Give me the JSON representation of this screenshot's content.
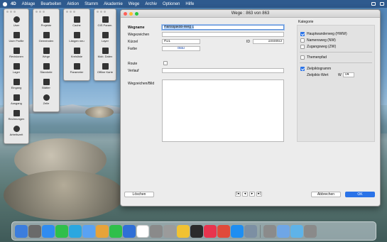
{
  "menubar": {
    "app": "4D",
    "items": [
      "Ablage",
      "Bearbeiten",
      "Aktion",
      "Stamm",
      "Akademie",
      "Wege",
      "Archiv",
      "Optionen",
      "Hilfe"
    ]
  },
  "palettes": {
    "p1": [
      "User",
      "User Profile",
      "Revisionen",
      "Lager",
      "Eingang",
      "Ausgang",
      "Rechnungen",
      "Arbeitszeit"
    ],
    "p2": [
      "Projekte",
      "Gemeinden",
      "Wege",
      "Standorte",
      "Blätter",
      "Zeile"
    ],
    "p3": [
      "Cache",
      "Längen neu",
      "Kreisliste",
      "Parameter"
    ],
    "p4": [
      "GIS Param.",
      "Layer",
      "Mob. Daten",
      "Offline Karte"
    ]
  },
  "window": {
    "title": "Wege : 863 von 863",
    "labels": {
      "wegname": "Wegname",
      "wegezeichen": "Wegezeichen",
      "kuerzel": "Kürzel",
      "farbe": "Farbe",
      "id": "ID",
      "route": "Route",
      "verlauf": "Verlauf",
      "wegzeichen_bild": "Wegzeichen/Bild"
    },
    "values": {
      "wegname": "Hanssjakob-Weg 1",
      "kuerzel": "HJ1",
      "farbe": "blau",
      "id": "1000003"
    },
    "kategorie": {
      "title": "Kategorie",
      "items": [
        {
          "label": "Hauptwanderweg (HWW)",
          "checked": true
        },
        {
          "label": "Namensweg (NW)",
          "checked": false
        },
        {
          "label": "Zugangsweg (ZW)",
          "checked": false
        },
        {
          "label": "Themenpfad",
          "checked": false
        },
        {
          "label": "Zielpiktogramm",
          "checked": true
        }
      ],
      "zielpikto_label": "Zielpikto Wert",
      "zielpikto_prefix": "W",
      "zielpikto_value": "04"
    },
    "buttons": {
      "delete": "Löschen",
      "cancel": "Abbrechen",
      "ok": "OK",
      "nav": [
        "|◂",
        "◂",
        "▸",
        "▸|"
      ]
    }
  },
  "dock": {
    "colors": [
      "#3b7ddd",
      "#6a6a6a",
      "#2f8cf0",
      "#2fbf4a",
      "#2aa7e0",
      "#5aa2f2",
      "#e7a33a",
      "#2fbf4a",
      "#2f6fd6",
      "#ffffff",
      "#8a8a8a",
      "#9b9b9b",
      "#f1c232",
      "#2b2b2b",
      "#e8344e",
      "#e04a3a",
      "#1f8ef1",
      "#7c8fa3",
      "#8b8b8b",
      "#6fa6e6",
      "#5fb3e8",
      "#8a8a8a"
    ]
  }
}
